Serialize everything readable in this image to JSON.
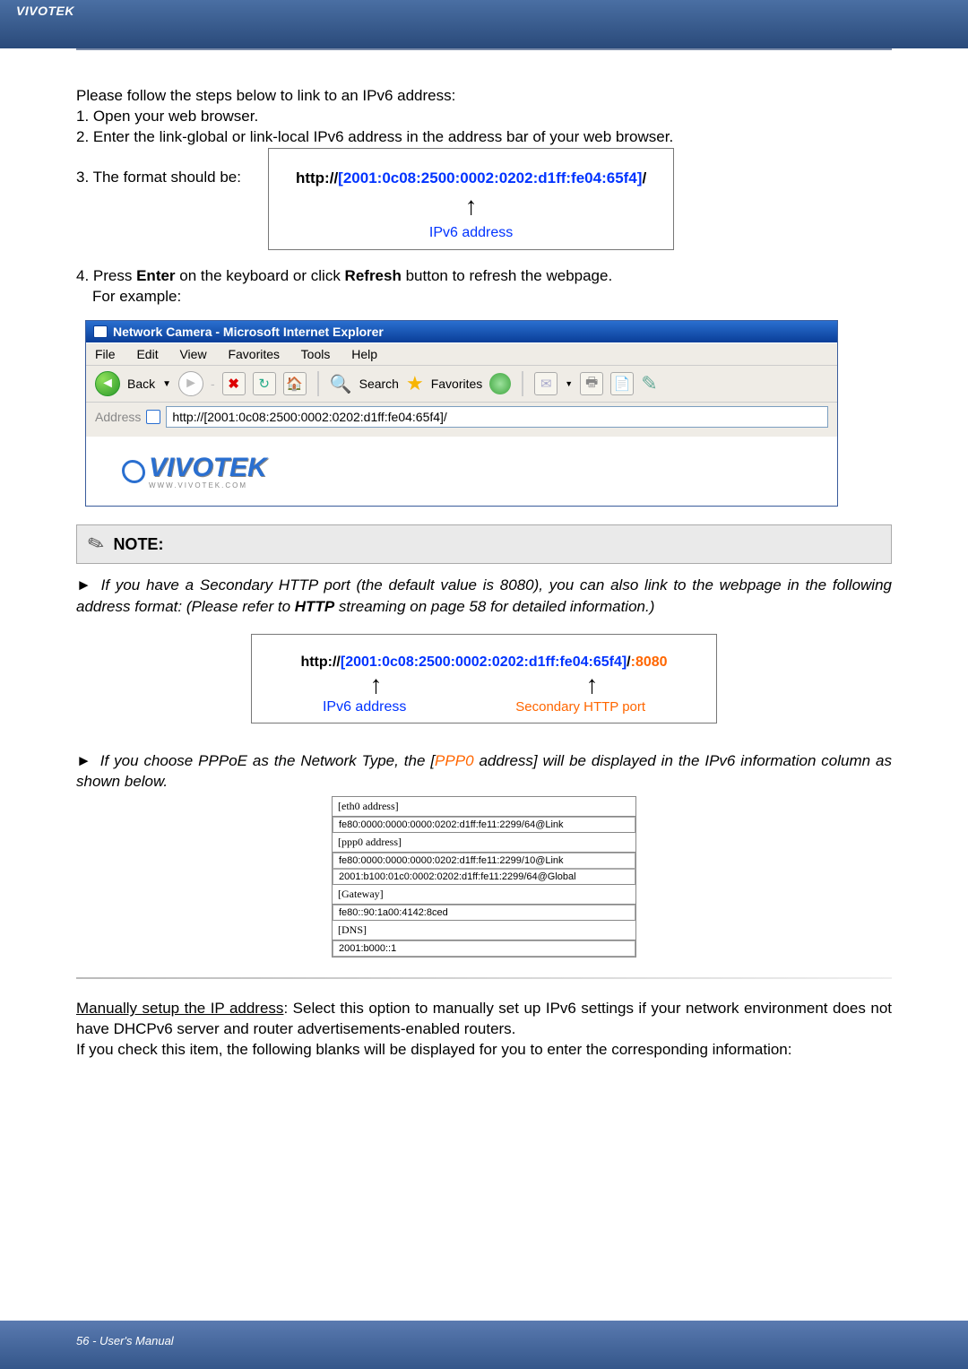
{
  "header": {
    "brand": "VIVOTEK"
  },
  "intro": {
    "line0": "Please follow the steps below to link to an IPv6 address:",
    "step1": "1. Open your web browser.",
    "step2": "2. Enter the link-global or link-local IPv6 address in the address bar of your web browser.",
    "step3_prefix": "3. The format should be:"
  },
  "urlbox1": {
    "prefix": "http://",
    "addr": "[2001:0c08:2500:0002:0202:d1ff:fe04:65f4]",
    "suffix": "/",
    "caption": "IPv6 address"
  },
  "step4": {
    "line1_a": "4. Press ",
    "enter": "Enter",
    "line1_b": " on the keyboard or click ",
    "refresh": "Refresh",
    "line1_c": " button to refresh the webpage.",
    "line2": "For example:"
  },
  "ie": {
    "title": "Network Camera - Microsoft Internet Explorer",
    "menus": [
      "File",
      "Edit",
      "View",
      "Favorites",
      "Tools",
      "Help"
    ],
    "back": "Back",
    "search": "Search",
    "favorites": "Favorites",
    "address_label": "Address",
    "address_value": "http://[2001:0c08:2500:0002:0202:d1ff:fe04:65f4]/",
    "logo_text": "VIVOTEK",
    "logo_under": "WWW.VIVOTEK.COM"
  },
  "note": {
    "title": "NOTE:",
    "bullet": "►",
    "para1_a": "If you have a Secondary HTTP port (the default value is 8080), you can also link to the webpage in the following address format: (Please refer to ",
    "http_word": "HTTP",
    "para1_b": " streaming on page 58 for detailed information.)"
  },
  "urlbox2": {
    "prefix": "http://",
    "addr": "[2001:0c08:2500:0002:0202:d1ff:fe04:65f4]",
    "slash": "/",
    "port": ":8080",
    "cap1": "IPv6 address",
    "cap2": "Secondary HTTP port"
  },
  "note2": {
    "a": "If you choose PPPoE as the Network Type, the [",
    "ppp0": "PPP0",
    "b": " address] will be displayed in the IPv6 information column as shown below."
  },
  "ipv6_info": {
    "eth0_hdr": "[eth0 address]",
    "eth0_val": "fe80:0000:0000:0000:0202:d1ff:fe11:2299/64@Link",
    "ppp0_hdr": "[ppp0 address]",
    "ppp0_val1": "fe80:0000:0000:0000:0202:d1ff:fe11:2299/10@Link",
    "ppp0_val2": "2001:b100:01c0:0002:0202:d1ff:fe11:2299/64@Global",
    "gateway_hdr": "[Gateway]",
    "gateway_val": "fe80::90:1a00:4142:8ced",
    "dns_hdr": "[DNS]",
    "dns_val": "2001:b000::1"
  },
  "manual": {
    "title": "Manually setup the IP address",
    "rest": ": Select this option to manually set up IPv6 settings if your network environment does not have DHCPv6 server and router advertisements-enabled routers.",
    "line2": "If you check this item, the following blanks will be displayed for you to enter the corresponding information:"
  },
  "footer": {
    "text": "56 - User's Manual"
  }
}
